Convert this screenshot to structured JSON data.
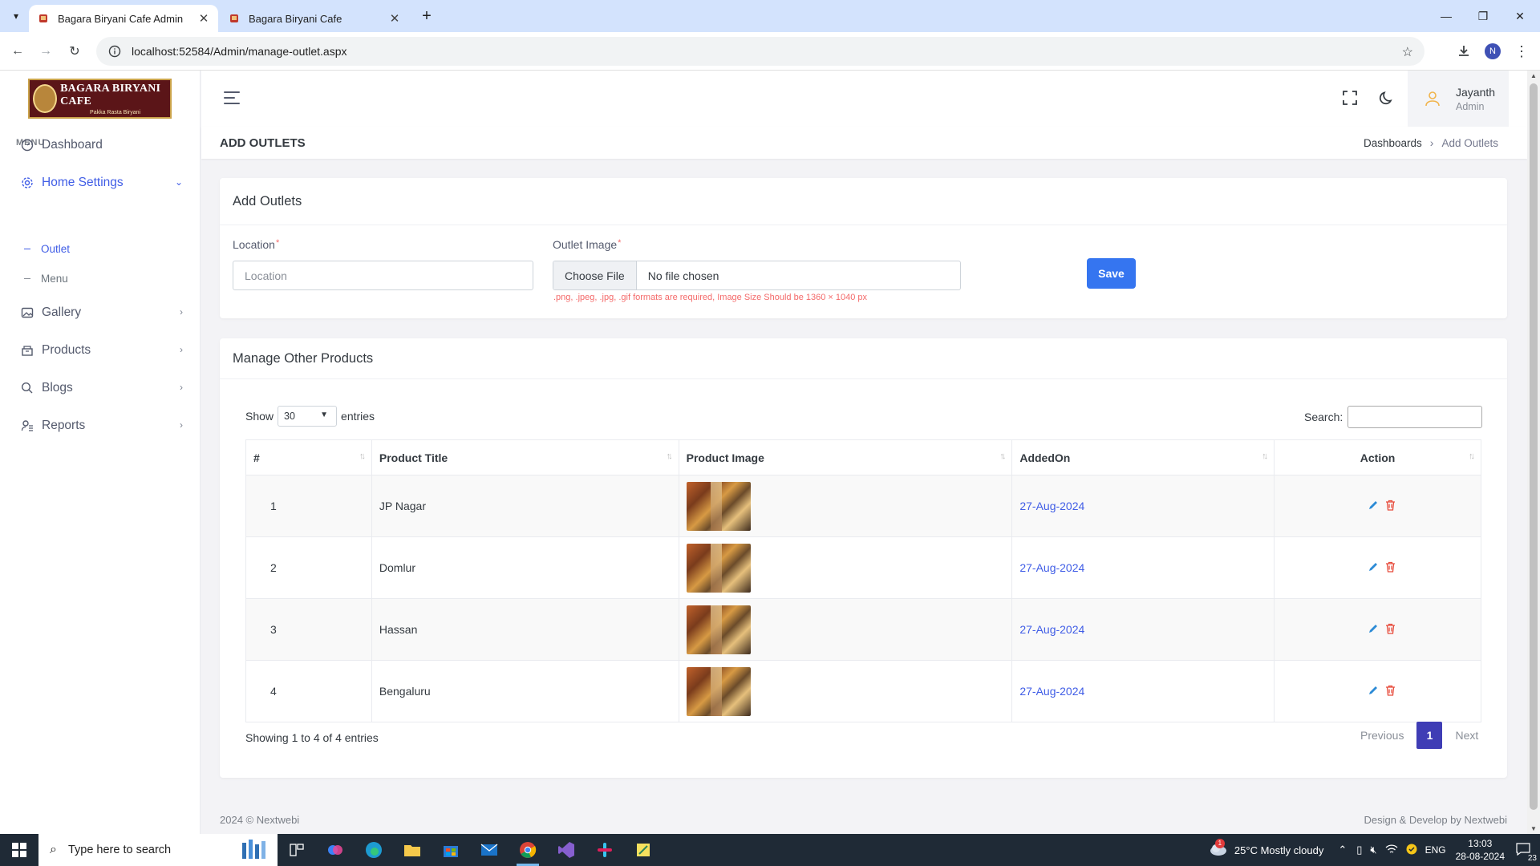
{
  "browser": {
    "tabs": [
      {
        "title": "Bagara Biryani Cafe Admin",
        "active": true
      },
      {
        "title": "Bagara Biryani Cafe",
        "active": false
      }
    ],
    "url": "localhost:52584/Admin/manage-outlet.aspx",
    "profile_initial": "N"
  },
  "logo": {
    "line1": "BAGARA BIRYANI CAFE",
    "line2": "Pakka Rasta Biryani"
  },
  "sidebar": {
    "menu_title": "MENU",
    "items": [
      {
        "label": "Dashboard",
        "icon": "dashboard-icon"
      },
      {
        "label": "Home Settings",
        "icon": "gear-icon",
        "active": true
      },
      {
        "label": "Gallery",
        "icon": "image-icon"
      },
      {
        "label": "Products",
        "icon": "products-icon"
      },
      {
        "label": "Blogs",
        "icon": "chat-icon"
      },
      {
        "label": "Reports",
        "icon": "user-list-icon"
      }
    ],
    "sub_items": [
      {
        "label": "Outlet",
        "active": true
      },
      {
        "label": "Menu"
      }
    ]
  },
  "header": {
    "user_name": "Jayanth",
    "user_role": "Admin"
  },
  "page": {
    "title": "ADD OUTLETS",
    "breadcrumb": [
      "Dashboards",
      "Add Outlets"
    ]
  },
  "form": {
    "card_title": "Add Outlets",
    "location_label": "Location",
    "location_placeholder": "Location",
    "image_label": "Outlet Image",
    "file_button": "Choose File",
    "file_status": "No file chosen",
    "hint": ".png, .jpeg, .jpg, .gif formats are required, Image Size Should be 1360 × 1040 px",
    "save_label": "Save"
  },
  "table_card": {
    "title": "Manage Other Products",
    "show_label": "Show",
    "entries_value": "30",
    "entries_label": "entries",
    "search_label": "Search:",
    "columns": [
      "#",
      "Product Title",
      "Product Image",
      "AddedOn",
      "Action"
    ],
    "rows": [
      {
        "num": "1",
        "title": "JP Nagar",
        "date": "27-Aug-2024"
      },
      {
        "num": "2",
        "title": "Domlur",
        "date": "27-Aug-2024"
      },
      {
        "num": "3",
        "title": "Hassan",
        "date": "27-Aug-2024"
      },
      {
        "num": "4",
        "title": "Bengaluru",
        "date": "27-Aug-2024"
      }
    ],
    "info": "Showing 1 to 4 of 4 entries",
    "pager": {
      "previous": "Previous",
      "page": "1",
      "next": "Next"
    }
  },
  "footer": {
    "left": "2024 © Nextwebi",
    "right": "Design & Develop by Nextwebi"
  },
  "taskbar": {
    "search_placeholder": "Type here to search",
    "weather": "25°C  Mostly cloudy",
    "weather_badge": "1",
    "lang": "ENG",
    "time": "13:03",
    "date": "28-08-2024",
    "notif_count": "23"
  },
  "colors": {
    "accent": "#405de6",
    "save_button": "#3575f0",
    "required": "#f46a6a",
    "pager_active": "#3f3db5"
  }
}
